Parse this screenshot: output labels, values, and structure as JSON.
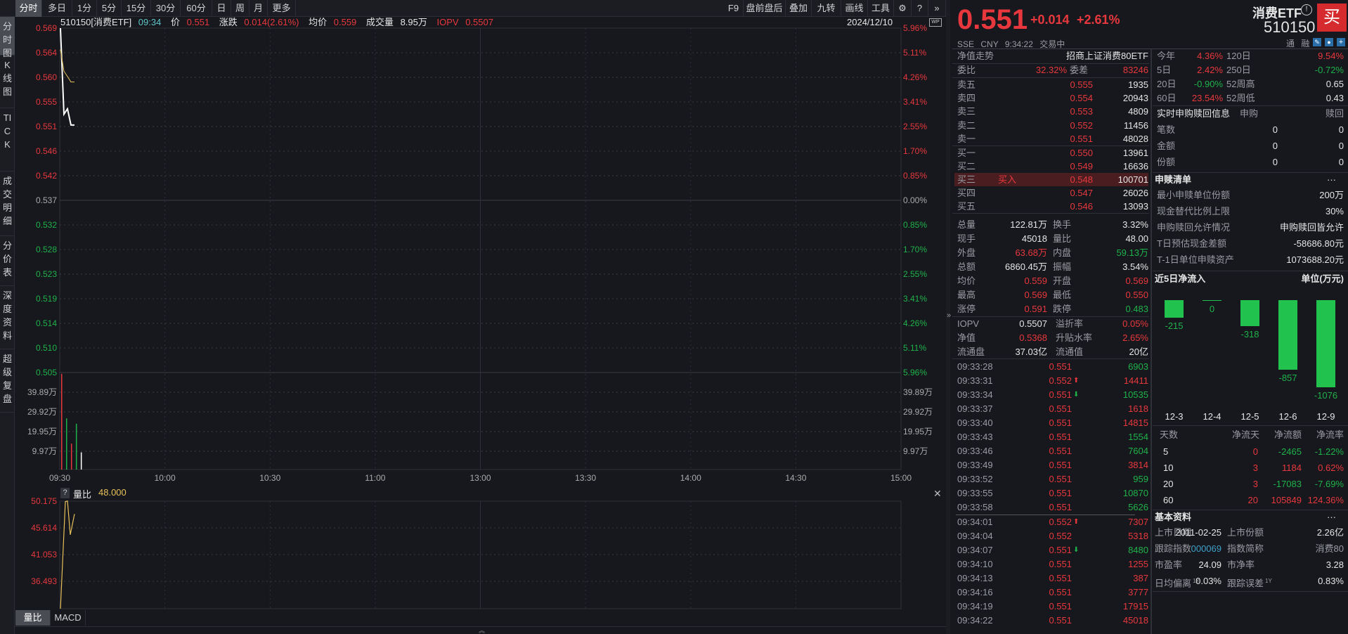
{
  "toolbar": {
    "periods": [
      "分时",
      "多日",
      "1分",
      "5分",
      "15分",
      "30分",
      "60分",
      "日",
      "周",
      "月",
      "更多"
    ],
    "active_period": "分时",
    "right_items": [
      "F9",
      "盘前盘后",
      "叠加",
      "九转",
      "画线",
      "工具"
    ],
    "settings_icon": "gear-icon",
    "help_icon": "question-icon",
    "expand_icon": "double-chevron-right-icon"
  },
  "sidebar": {
    "items": [
      "分时图",
      "K线图",
      "TICK",
      "成交明细",
      "分价表",
      "深度资料",
      "超级复盘"
    ],
    "active": "分时图"
  },
  "info_bar": {
    "code_name": "510150[消费ETF]",
    "time": "09:34",
    "price_label": "价",
    "price": "0.551",
    "change_label": "涨跌",
    "change": "0.014(2.61%)",
    "avg_label": "均价",
    "avg": "0.559",
    "volume_label": "成交量",
    "volume": "8.95万",
    "iopv_label": "IOPV",
    "iopv": "0.5507",
    "date": "2024/12/10"
  },
  "chart_data": [
    {
      "type": "line",
      "prev_close": 0.537,
      "ylim": [
        0.505,
        0.569
      ],
      "left_ticks": [
        "0.569",
        "0.564",
        "0.560",
        "0.555",
        "0.551",
        "0.546",
        "0.542",
        "0.537",
        "0.532",
        "0.528",
        "0.523",
        "0.519",
        "0.514",
        "0.510",
        "0.505"
      ],
      "right_ticks": [
        "5.96%",
        "5.11%",
        "4.26%",
        "3.41%",
        "2.55%",
        "1.70%",
        "0.85%",
        "0.00%",
        "0.85%",
        "1.70%",
        "2.55%",
        "3.41%",
        "4.26%",
        "5.11%",
        "5.96%"
      ],
      "x_ticks": [
        "09:30",
        "10:00",
        "10:30",
        "11:00",
        "13:00",
        "13:30",
        "14:00",
        "14:30",
        "15:00"
      ],
      "series": [
        {
          "key": "price",
          "color": "#ffffff",
          "x": [
            "09:30",
            "09:31",
            "09:32",
            "09:33",
            "09:34"
          ],
          "values": [
            0.569,
            0.553,
            0.554,
            0.551,
            0.551
          ]
        },
        {
          "key": "avg",
          "color": "#e8c15a",
          "x": [
            "09:30",
            "09:31",
            "09:32",
            "09:33",
            "09:34"
          ],
          "values": [
            0.565,
            0.561,
            0.56,
            0.559,
            0.559
          ]
        }
      ]
    },
    {
      "type": "bar",
      "unit": "万",
      "ylim": [
        0,
        49.86
      ],
      "ticks": [
        "39.89万",
        "29.92万",
        "19.95万",
        "9.97万"
      ],
      "categories": [
        "09:30",
        "09:31",
        "09:32",
        "09:33",
        "09:34"
      ],
      "values": [
        49.9,
        26.7,
        13.5,
        23.9,
        8.95
      ],
      "colors": [
        "#e8383d",
        "#1fb24a",
        "#e8383d",
        "#1fb24a",
        "#ffffff"
      ]
    },
    {
      "type": "line",
      "title": "量比",
      "value_label": "48.000",
      "ylim": [
        32.0,
        50.175
      ],
      "ticks": [
        "50.175",
        "45.614",
        "41.053",
        "36.493"
      ],
      "x": [
        "09:30",
        "09:31",
        "09:32",
        "09:33",
        "09:34"
      ],
      "values": [
        32.0,
        50.1,
        50.2,
        44.5,
        48.0
      ]
    }
  ],
  "sub_tabs": [
    "量比",
    "MACD"
  ],
  "quote": {
    "price": "0.551",
    "change": "+0.014",
    "change_pct": "+2.61%",
    "name": "消费ETF",
    "code": "510150",
    "buy_label": "买",
    "exchange": "SSE",
    "currency": "CNY",
    "time": "9:34:22",
    "status": "交易中",
    "tags": [
      "通",
      "融"
    ]
  },
  "order_book": {
    "nav_label": "净值走势",
    "fund_name": "招商上证消费80ETF",
    "ratio_label": "委比",
    "ratio": "32.32%",
    "diff_label": "委差",
    "diff": "83246",
    "asks": [
      {
        "label": "卖五",
        "price": "0.555",
        "vol": "1935"
      },
      {
        "label": "卖四",
        "price": "0.554",
        "vol": "20943"
      },
      {
        "label": "卖三",
        "price": "0.553",
        "vol": "4809"
      },
      {
        "label": "卖二",
        "price": "0.552",
        "vol": "11456"
      },
      {
        "label": "卖一",
        "price": "0.551",
        "vol": "48028"
      }
    ],
    "bids": [
      {
        "label": "买一",
        "price": "0.550",
        "vol": "13961",
        "tag": ""
      },
      {
        "label": "买二",
        "price": "0.549",
        "vol": "16636",
        "tag": ""
      },
      {
        "label": "买三",
        "price": "0.548",
        "vol": "100701",
        "tag": "买入"
      },
      {
        "label": "买四",
        "price": "0.547",
        "vol": "26026",
        "tag": ""
      },
      {
        "label": "买五",
        "price": "0.546",
        "vol": "13093",
        "tag": ""
      }
    ]
  },
  "stats": [
    [
      {
        "l": "总量",
        "v": "122.81万",
        "c": "white"
      },
      {
        "l": "换手",
        "v": "3.32%",
        "c": "white"
      }
    ],
    [
      {
        "l": "现手",
        "v": "45018",
        "c": "white"
      },
      {
        "l": "量比",
        "v": "48.00",
        "c": "white"
      }
    ],
    [
      {
        "l": "外盘",
        "v": "63.68万",
        "c": "red"
      },
      {
        "l": "内盘",
        "v": "59.13万",
        "c": "green"
      }
    ],
    [
      {
        "l": "总额",
        "v": "6860.45万",
        "c": "white"
      },
      {
        "l": "振幅",
        "v": "3.54%",
        "c": "white"
      }
    ],
    [
      {
        "l": "均价",
        "v": "0.559",
        "c": "red"
      },
      {
        "l": "开盘",
        "v": "0.569",
        "c": "red"
      }
    ],
    [
      {
        "l": "最高",
        "v": "0.569",
        "c": "red"
      },
      {
        "l": "最低",
        "v": "0.550",
        "c": "red"
      }
    ],
    [
      {
        "l": "涨停",
        "v": "0.591",
        "c": "red"
      },
      {
        "l": "跌停",
        "v": "0.483",
        "c": "green"
      }
    ]
  ],
  "etf_stats": [
    [
      {
        "l": "IOPV",
        "v": "0.5507",
        "c": "white"
      },
      {
        "l": "溢折率",
        "v": "0.05%",
        "c": "red"
      }
    ],
    [
      {
        "l": "净值",
        "v": "0.5368",
        "c": "red"
      },
      {
        "l": "升贴水率",
        "v": "2.65%",
        "c": "red"
      }
    ],
    [
      {
        "l": "流通盘",
        "v": "37.03亿",
        "c": "white"
      },
      {
        "l": "流通值",
        "v": "20亿",
        "c": "white"
      }
    ]
  ],
  "ticks": [
    {
      "t": "09:33:28",
      "p": "0.551",
      "a": "",
      "v": "6903",
      "c": "green"
    },
    {
      "t": "09:33:31",
      "p": "0.552",
      "a": "up",
      "v": "14411",
      "c": "red"
    },
    {
      "t": "09:33:34",
      "p": "0.551",
      "a": "down",
      "v": "10535",
      "c": "green"
    },
    {
      "t": "09:33:37",
      "p": "0.551",
      "a": "",
      "v": "1618",
      "c": "red"
    },
    {
      "t": "09:33:40",
      "p": "0.551",
      "a": "",
      "v": "14815",
      "c": "red"
    },
    {
      "t": "09:33:43",
      "p": "0.551",
      "a": "",
      "v": "1554",
      "c": "green"
    },
    {
      "t": "09:33:46",
      "p": "0.551",
      "a": "",
      "v": "7604",
      "c": "green"
    },
    {
      "t": "09:33:49",
      "p": "0.551",
      "a": "",
      "v": "3814",
      "c": "red"
    },
    {
      "t": "09:33:52",
      "p": "0.551",
      "a": "",
      "v": "959",
      "c": "green"
    },
    {
      "t": "09:33:55",
      "p": "0.551",
      "a": "",
      "v": "10870",
      "c": "green"
    },
    {
      "t": "09:33:58",
      "p": "0.551",
      "a": "",
      "v": "5626",
      "c": "green"
    },
    {
      "t": "09:34:01",
      "p": "0.552",
      "a": "up",
      "v": "7307",
      "c": "red"
    },
    {
      "t": "09:34:04",
      "p": "0.552",
      "a": "",
      "v": "5318",
      "c": "red"
    },
    {
      "t": "09:34:07",
      "p": "0.551",
      "a": "down",
      "v": "8480",
      "c": "green"
    },
    {
      "t": "09:34:10",
      "p": "0.551",
      "a": "",
      "v": "1255",
      "c": "red"
    },
    {
      "t": "09:34:13",
      "p": "0.551",
      "a": "",
      "v": "387",
      "c": "red"
    },
    {
      "t": "09:34:16",
      "p": "0.551",
      "a": "",
      "v": "3777",
      "c": "red"
    },
    {
      "t": "09:34:19",
      "p": "0.551",
      "a": "",
      "v": "17915",
      "c": "red"
    },
    {
      "t": "09:34:22",
      "p": "0.551",
      "a": "",
      "v": "45018",
      "c": "red"
    }
  ],
  "returns": [
    [
      {
        "l": "今年",
        "v": "4.36%",
        "c": "red"
      },
      {
        "l": "120日",
        "v": "9.54%",
        "c": "red"
      }
    ],
    [
      {
        "l": "5日",
        "v": "2.42%",
        "c": "red"
      },
      {
        "l": "250日",
        "v": "-0.72%",
        "c": "green"
      }
    ],
    [
      {
        "l": "20日",
        "v": "-0.90%",
        "c": "green"
      },
      {
        "l": "52周高",
        "v": "0.65",
        "c": "white"
      }
    ],
    [
      {
        "l": "60日",
        "v": "23.54%",
        "c": "red"
      },
      {
        "l": "52周低",
        "v": "0.43",
        "c": "white"
      }
    ]
  ],
  "realtime_sr": {
    "title": "实时申购赎回信息",
    "col1": "申购",
    "col2": "赎回",
    "rows": [
      {
        "l": "笔数",
        "a": "0",
        "b": "0"
      },
      {
        "l": "金额",
        "a": "0",
        "b": "0"
      },
      {
        "l": "份额",
        "a": "0",
        "b": "0"
      }
    ]
  },
  "sr_list": {
    "title": "申赎清单",
    "more": "···",
    "rows": [
      {
        "l": "最小申赎单位份额",
        "v": "200万"
      },
      {
        "l": "现金替代比例上限",
        "v": "30%"
      },
      {
        "l": "申购赎回允许情况",
        "v": "申购赎回皆允许"
      },
      {
        "l": "T日预估现金差额",
        "v": "-58686.80元"
      },
      {
        "l": "T-1日单位申赎资产",
        "v": "1073688.20元"
      }
    ]
  },
  "net_inflow": {
    "title": "近5日净流入",
    "unit": "单位(万元)",
    "chart": {
      "type": "bar",
      "categories": [
        "12-3",
        "12-4",
        "12-5",
        "12-6",
        "12-9"
      ],
      "values": [
        -215,
        0,
        -318,
        -857,
        -1076
      ],
      "labels": [
        "-215",
        "0",
        "-318",
        "-857",
        "-1076"
      ],
      "color": "#22c24f"
    },
    "table_headers": [
      "天数",
      "净流天",
      "净流额",
      "净流率"
    ],
    "table_rows": [
      {
        "d": "5",
        "n": "0",
        "a": "-2465",
        "r": "-1.22%",
        "nc": "red",
        "ac": "green",
        "rc": "green"
      },
      {
        "d": "10",
        "n": "3",
        "a": "1184",
        "r": "0.62%",
        "nc": "red",
        "ac": "red",
        "rc": "red"
      },
      {
        "d": "20",
        "n": "3",
        "a": "-17083",
        "r": "-7.69%",
        "nc": "red",
        "ac": "green",
        "rc": "green"
      },
      {
        "d": "60",
        "n": "20",
        "a": "105849",
        "r": "124.36%",
        "nc": "red",
        "ac": "red",
        "rc": "red"
      }
    ]
  },
  "basic_info": {
    "title": "基本资料",
    "more": "···",
    "rows": [
      [
        {
          "l": "上市日期",
          "v": "2011-02-25",
          "c": "white",
          "sup": ""
        },
        {
          "l": "上市份额",
          "v": "2.26亿",
          "c": "white",
          "sup": ""
        }
      ],
      [
        {
          "l": "跟踪指数",
          "v": "000069",
          "c": "blue",
          "sup": ""
        },
        {
          "l": "指数简称",
          "v": "消费80",
          "c": "gray",
          "sup": ""
        }
      ],
      [
        {
          "l": "市盈率",
          "v": "24.09",
          "c": "white",
          "sup": ""
        },
        {
          "l": "市净率",
          "v": "3.28",
          "c": "white",
          "sup": ""
        }
      ],
      [
        {
          "l": "日均偏离",
          "v": "0.03%",
          "c": "white",
          "sup": "1Y"
        },
        {
          "l": "跟踪误差",
          "v": "0.83%",
          "c": "white",
          "sup": "1Y"
        }
      ]
    ]
  },
  "colors": {
    "up": "#e8383d",
    "down": "#1fb24a",
    "avg": "#e8c15a",
    "background": "#16181d"
  }
}
